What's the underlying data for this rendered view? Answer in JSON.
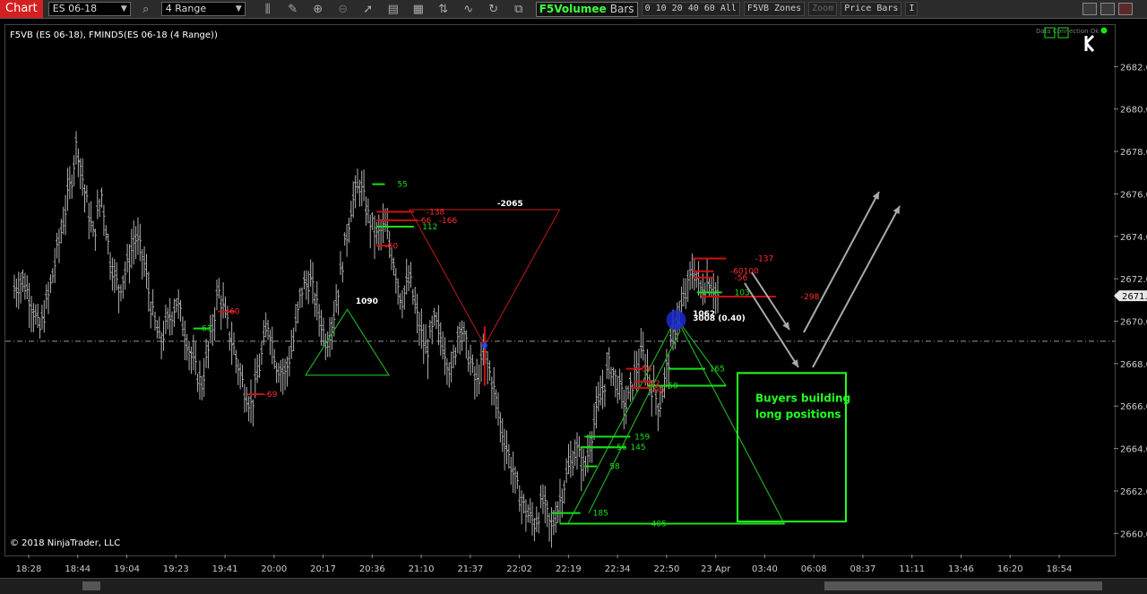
{
  "toolbar": {
    "chart_label": "Chart",
    "instrument": "ES 06-18",
    "bar_type": "4 Range",
    "f5_label_a": "F5Volumee",
    "f5_label_b": "Bars",
    "periods": "0 10 20 40 60 All",
    "zones_label": "F5VB Zones",
    "zoom_label": "Zoom",
    "price_bars_label": "Price Bars",
    "i_label": "I"
  },
  "chart_data": {
    "type": "ohlc-range-bars",
    "title": "F5VB (ES 06-18), FMIND5(ES 06-18 (4 Range))",
    "copyright": "© 2018 NinjaTrader, LLC",
    "connection_status": "Data Connection Ok",
    "current_price_label": "2671.2",
    "ylim": [
      2659.0,
      2684.0
    ],
    "y_ticks": [
      2660,
      2662,
      2664,
      2666,
      2668,
      2670,
      2672,
      2674,
      2676,
      2678,
      2680,
      2682
    ],
    "y_tick_labels": [
      "2660.0",
      "2662.0",
      "2664.0",
      "2666.0",
      "2668.0",
      "2670.0",
      "2672.0",
      "2674.0",
      "2676.0",
      "2678.0",
      "2680.0",
      "2682.0"
    ],
    "x_ticks": [
      "18:28",
      "18:44",
      "19:04",
      "19:23",
      "19:41",
      "20:00",
      "20:17",
      "20:36",
      "21:10",
      "21:37",
      "22:02",
      "22:19",
      "22:34",
      "22:50",
      "23 Apr",
      "03:40",
      "06:08",
      "08:37",
      "11:11",
      "13:46",
      "16:20",
      "18:54"
    ],
    "horizontal_line": 2669.1,
    "price_path": [
      [
        0,
        2671.5
      ],
      [
        2,
        2672.0
      ],
      [
        4,
        2671.0
      ],
      [
        6,
        2669.5
      ],
      [
        8,
        2671.0
      ],
      [
        10,
        2673.0
      ],
      [
        12,
        2675.0
      ],
      [
        14,
        2677.0
      ],
      [
        15,
        2678.5
      ],
      [
        17,
        2676.0
      ],
      [
        19,
        2674.0
      ],
      [
        21,
        2676.0
      ],
      [
        23,
        2673.0
      ],
      [
        25,
        2671.5
      ],
      [
        27,
        2672.5
      ],
      [
        29,
        2674.0
      ],
      [
        31,
        2673.0
      ],
      [
        33,
        2670.5
      ],
      [
        35,
        2669.0
      ],
      [
        37,
        2670.0
      ],
      [
        39,
        2671.0
      ],
      [
        41,
        2669.5
      ],
      [
        43,
        2668.0
      ],
      [
        45,
        2667.0
      ],
      [
        47,
        2669.0
      ],
      [
        49,
        2671.5
      ],
      [
        51,
        2670.0
      ],
      [
        53,
        2668.5
      ],
      [
        55,
        2667.0
      ],
      [
        57,
        2666.0
      ],
      [
        59,
        2668.0
      ],
      [
        61,
        2670.0
      ],
      [
        63,
        2668.0
      ],
      [
        65,
        2667.5
      ],
      [
        67,
        2669.0
      ],
      [
        69,
        2671.5
      ],
      [
        71,
        2672.0
      ],
      [
        73,
        2670.5
      ],
      [
        75,
        2669.0
      ],
      [
        77,
        2670.5
      ],
      [
        79,
        2673.0
      ],
      [
        81,
        2675.5
      ],
      [
        83,
        2676.5
      ],
      [
        85,
        2675.0
      ],
      [
        87,
        2674.0
      ],
      [
        89,
        2674.5
      ],
      [
        91,
        2673.0
      ],
      [
        93,
        2671.0
      ],
      [
        95,
        2672.0
      ],
      [
        97,
        2670.0
      ],
      [
        99,
        2668.5
      ],
      [
        101,
        2670.0
      ],
      [
        103,
        2669.0
      ],
      [
        105,
        2667.5
      ],
      [
        107,
        2670.0
      ],
      [
        109,
        2668.5
      ],
      [
        111,
        2667.0
      ],
      [
        113,
        2668.5
      ],
      [
        115,
        2667.0
      ],
      [
        117,
        2665.0
      ],
      [
        119,
        2663.5
      ],
      [
        121,
        2662.0
      ],
      [
        123,
        2661.0
      ],
      [
        125,
        2660.5
      ],
      [
        127,
        2661.5
      ],
      [
        129,
        2660.2
      ],
      [
        131,
        2661.5
      ],
      [
        133,
        2663.0
      ],
      [
        135,
        2664.0
      ],
      [
        137,
        2663.0
      ],
      [
        139,
        2665.0
      ],
      [
        141,
        2666.5
      ],
      [
        143,
        2668.0
      ],
      [
        145,
        2667.0
      ],
      [
        147,
        2666.0
      ],
      [
        149,
        2667.5
      ],
      [
        151,
        2668.5
      ],
      [
        153,
        2667.0
      ],
      [
        155,
        2666.0
      ],
      [
        157,
        2668.0
      ],
      [
        159,
        2670.0
      ],
      [
        161,
        2671.0
      ],
      [
        163,
        2672.5
      ],
      [
        165,
        2671.5
      ],
      [
        167,
        2672.0
      ],
      [
        169,
        2671.2
      ]
    ],
    "bar_range": [
      0,
      169
    ],
    "delta_labels": [
      {
        "text": "63",
        "color": "green",
        "bar": 45,
        "price": 2669.7
      },
      {
        "text": "-60",
        "color": "red",
        "bar": 51,
        "price": 2670.5
      },
      {
        "text": "-69",
        "color": "red",
        "bar": 60,
        "price": 2666.6
      },
      {
        "text": "1090",
        "color": "white",
        "bar": 82,
        "price": 2671.0
      },
      {
        "text": "55",
        "color": "green",
        "bar": 92,
        "price": 2676.5
      },
      {
        "text": "-138",
        "color": "red",
        "bar": 99,
        "price": 2675.2
      },
      {
        "text": "-66",
        "color": "red",
        "bar": 97,
        "price": 2674.8
      },
      {
        "text": "-166",
        "color": "red",
        "bar": 102,
        "price": 2674.8
      },
      {
        "text": "112",
        "color": "green",
        "bar": 98,
        "price": 2674.5
      },
      {
        "text": "-60",
        "color": "red",
        "bar": 89,
        "price": 2673.6
      },
      {
        "text": "-2065",
        "color": "white",
        "bar": 116,
        "price": 2675.6
      },
      {
        "text": "-56",
        "color": "red",
        "bar": 150,
        "price": 2667.8
      },
      {
        "text": "-52",
        "color": "red",
        "bar": 152,
        "price": 2667.1
      },
      {
        "text": "-90",
        "color": "red",
        "bar": 153,
        "price": 2666.8
      },
      {
        "text": "58",
        "color": "green",
        "bar": 157,
        "price": 2667.0
      },
      {
        "text": "165",
        "color": "green",
        "bar": 167,
        "price": 2667.8
      },
      {
        "text": "159",
        "color": "green",
        "bar": 149,
        "price": 2664.6
      },
      {
        "text": "-56",
        "color": "green",
        "bar": 144,
        "price": 2664.1
      },
      {
        "text": "145",
        "color": "green",
        "bar": 148,
        "price": 2664.1
      },
      {
        "text": "58",
        "color": "green",
        "bar": 143,
        "price": 2663.2
      },
      {
        "text": "185",
        "color": "green",
        "bar": 139,
        "price": 2661.0
      },
      {
        "text": "405",
        "color": "green",
        "bar": 153,
        "price": 2660.5
      },
      {
        "text": "-137",
        "color": "red",
        "bar": 178,
        "price": 2673.0
      },
      {
        "text": "-60100",
        "color": "red",
        "bar": 172,
        "price": 2672.4
      },
      {
        "text": "-56",
        "color": "red",
        "bar": 173,
        "price": 2672.1
      },
      {
        "text": "103",
        "color": "green",
        "bar": 173,
        "price": 2671.4
      },
      {
        "text": "-298",
        "color": "red",
        "bar": 189,
        "price": 2671.2
      },
      {
        "text": "1062",
        "color": "white",
        "bar": 163,
        "price": 2670.4
      },
      {
        "text": "3008 (0.40)",
        "color": "white",
        "bar": 163,
        "price": 2670.2
      }
    ],
    "annotation_box_text": [
      "Buyers building",
      "long positions"
    ],
    "accent_green": "#18e018",
    "accent_red": "#d01010"
  }
}
